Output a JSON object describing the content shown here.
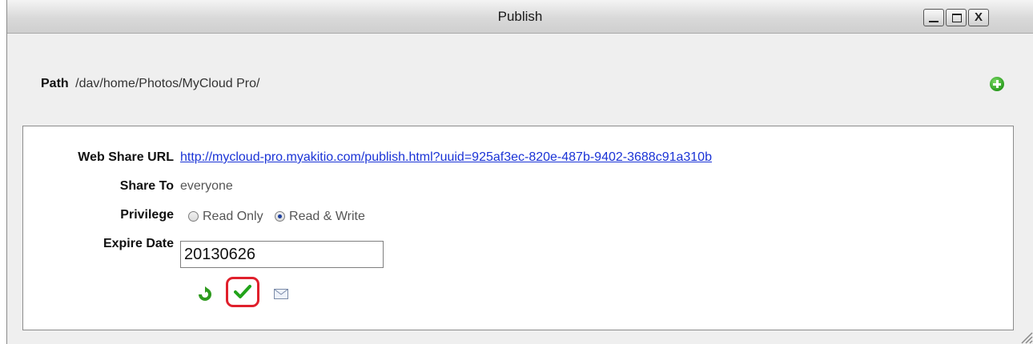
{
  "window": {
    "title": "Publish",
    "controls": {
      "close": "X"
    }
  },
  "path": {
    "label": "Path",
    "value": "/dav/home/Photos/MyCloud Pro/",
    "add_icon": "add-icon"
  },
  "share": {
    "web_share_url_label": "Web Share URL",
    "web_share_url": "http://mycloud-pro.myakitio.com/publish.html?uuid=925af3ec-820e-487b-9402-3688c91a310b",
    "share_to_label": "Share To",
    "share_to_value": "everyone",
    "privilege_label": "Privilege",
    "privilege_options": [
      "Read Only",
      "Read & Write"
    ],
    "privilege_selected": "Read & Write",
    "expire_date_label": "Expire Date",
    "expire_date_value": "20130626"
  },
  "actions": {
    "refresh_icon": "refresh-icon",
    "confirm_icon": "checkmark-icon",
    "email_icon": "envelope-icon",
    "highlight_color": "#e0202c"
  },
  "colors": {
    "link": "#1a33d6",
    "add_green": "#2b9c1f",
    "check_green": "#22a31a"
  }
}
